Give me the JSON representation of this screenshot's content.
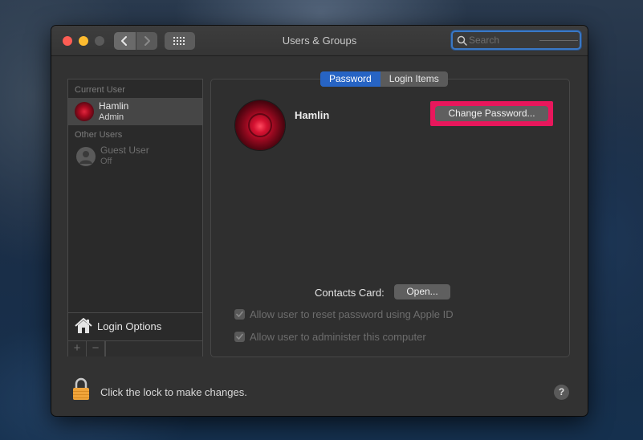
{
  "window": {
    "title": "Users & Groups"
  },
  "toolbar": {
    "search_placeholder": "Search"
  },
  "sidebar": {
    "current_user_label": "Current User",
    "current_user": {
      "name": "Hamlin",
      "role": "Admin"
    },
    "other_users_label": "Other Users",
    "other_users": [
      {
        "name": "Guest User",
        "status": "Off"
      }
    ],
    "login_options_label": "Login Options",
    "add_label": "+",
    "remove_label": "−"
  },
  "tabs": [
    {
      "label": "Password",
      "active": true
    },
    {
      "label": "Login Items",
      "active": false
    }
  ],
  "profile": {
    "name": "Hamlin",
    "change_password_label": "Change Password...",
    "contacts_card_label": "Contacts Card:",
    "open_label": "Open...",
    "options": [
      {
        "label": "Allow user to reset password using Apple ID",
        "checked": true,
        "enabled": false
      },
      {
        "label": "Allow user to administer this computer",
        "checked": true,
        "enabled": false
      }
    ]
  },
  "footer": {
    "lock_text": "Click the lock to make changes.",
    "help_label": "?"
  },
  "colors": {
    "accent": "#2764c4",
    "highlight": "#e8175c",
    "close": "#fd5d54",
    "minimize": "#fdbb2f"
  }
}
